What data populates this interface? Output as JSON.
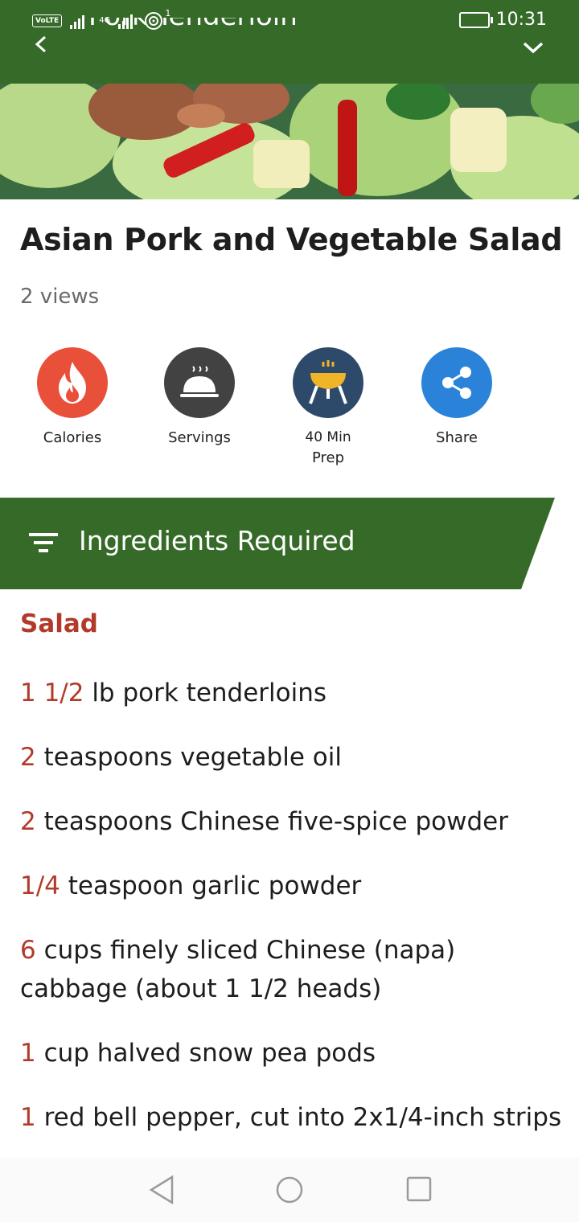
{
  "status_bar": {
    "volte": "VoLTE",
    "network": "4G",
    "notification_count": "1",
    "time": "10:31"
  },
  "app_bar": {
    "title": "Pork Tenderloin",
    "background_color": "#356a28"
  },
  "recipe": {
    "title": "Asian Pork and Vegetable Salad",
    "views": "2 views"
  },
  "actions": [
    {
      "label": "Calories",
      "sub": "",
      "icon": "flame-icon",
      "color": "#e8503a"
    },
    {
      "label": "Servings",
      "sub": "",
      "icon": "serving-dish-icon",
      "color": "#424242"
    },
    {
      "label": "Prep",
      "sub": "40 Min",
      "icon": "grill-icon",
      "color": "#2d4a6a"
    },
    {
      "label": "Share",
      "sub": "",
      "icon": "share-icon",
      "color": "#2a83d8"
    }
  ],
  "ingredients_section": {
    "header": "Ingredients Required",
    "group_title": "Salad",
    "items": [
      {
        "qty": "1 1/2",
        "text": " lb pork tenderloins"
      },
      {
        "qty": "2",
        "text": " teaspoons vegetable oil"
      },
      {
        "qty": "2",
        "text": " teaspoons Chinese five-spice powder"
      },
      {
        "qty": "1/4",
        "text": " teaspoon garlic powder"
      },
      {
        "qty": "6",
        "text": " cups finely sliced Chinese (napa) cabbage (about 1 1/2 heads)"
      },
      {
        "qty": "1",
        "text": " cup halved snow pea pods"
      },
      {
        "qty": "1",
        "text": " red bell pepper, cut into 2x1/4-inch strips"
      }
    ]
  },
  "colors": {
    "accent_red": "#b23a2b",
    "primary_green": "#356a28"
  }
}
